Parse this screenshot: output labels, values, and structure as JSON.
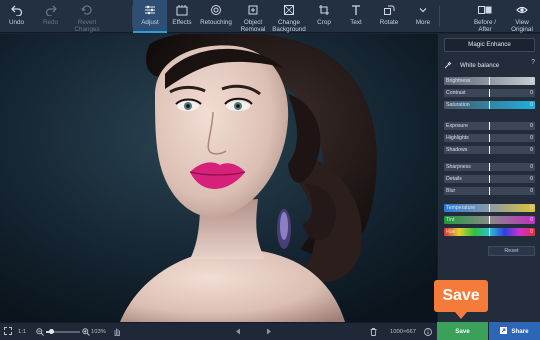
{
  "toolbar": {
    "undo": "Undo",
    "redo": "Redo",
    "revert": "Revert\nChanges",
    "adjust": "Adjust",
    "effects": "Effects",
    "retouching": "Retouching",
    "object_removal": "Object\nRemoval",
    "change_background": "Change\nBackground",
    "crop": "Crop",
    "text": "Text",
    "rotate": "Rotate",
    "more": "More",
    "before_after": "Before /\nAfter",
    "view_original": "View\nOriginal"
  },
  "panel": {
    "magic_enhance": "Magic Enhance",
    "white_balance": "White balance",
    "help": "?",
    "reset": "Reset",
    "sliders": [
      {
        "name": "Brightness",
        "value": "0",
        "gradient": "linear-gradient(90deg,#5c6472,#c8ccd3)"
      },
      {
        "name": "Contrast",
        "value": "0",
        "gradient": "linear-gradient(90deg,#3c4657,#3c4657)"
      },
      {
        "name": "Saturation",
        "value": "0",
        "gradient": "linear-gradient(90deg,#4a5566,#1fb0e0)"
      },
      {
        "name": "Exposure",
        "value": "0",
        "gradient": "linear-gradient(90deg,#3c4657,#3c4657)"
      },
      {
        "name": "Highlights",
        "value": "0",
        "gradient": "linear-gradient(90deg,#3c4657,#3c4657)"
      },
      {
        "name": "Shadows",
        "value": "0",
        "gradient": "linear-gradient(90deg,#3c4657,#3c4657)"
      },
      {
        "name": "Sharpness",
        "value": "0",
        "gradient": "linear-gradient(90deg,#3c4657,#3c4657)"
      },
      {
        "name": "Details",
        "value": "0",
        "gradient": "linear-gradient(90deg,#3c4657,#3c4657)"
      },
      {
        "name": "Blur",
        "value": "0",
        "gradient": "linear-gradient(90deg,#3c4657,#3c4657)"
      },
      {
        "name": "Temperature",
        "value": "0",
        "gradient": "linear-gradient(90deg,#2b7bd6,#8a9aa8,#e0c23a)"
      },
      {
        "name": "Tint",
        "value": "0",
        "gradient": "linear-gradient(90deg,#1c9a3a,#8a8a8a,#c02fc0)"
      },
      {
        "name": "Hue",
        "value": "0",
        "gradient": "linear-gradient(90deg,#e03030,#e0d030,#30c040,#30c0d0,#3040e0,#d030d0,#e03030)"
      }
    ]
  },
  "bottombar": {
    "fit": "1:1",
    "zoom": "103%",
    "dimensions": "1000×667"
  },
  "actions": {
    "save": "Save",
    "share": "Share"
  },
  "callout": {
    "label": "Save"
  },
  "colors": {
    "accent": "#2a9fd8",
    "save": "#3aa05a",
    "share": "#2c66b5",
    "callout": "#f47b3a",
    "lips": "#d6207a"
  }
}
